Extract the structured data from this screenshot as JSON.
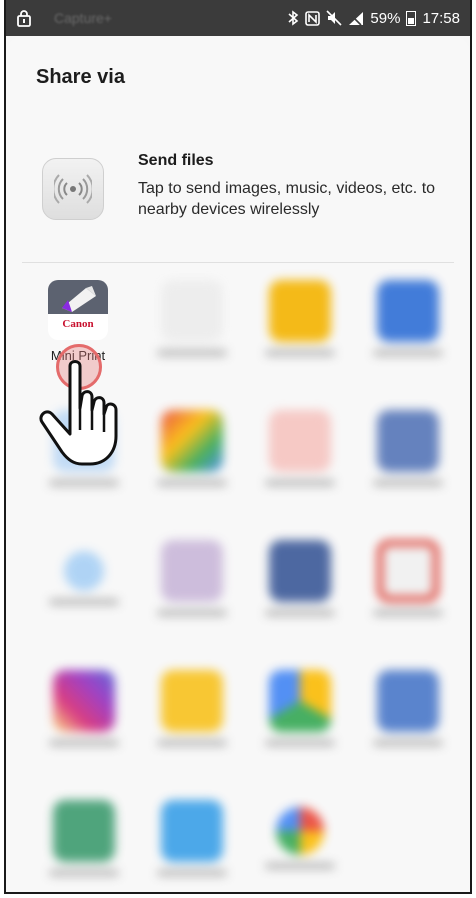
{
  "status_bar": {
    "ghost_app_text": "Capture+",
    "battery_percent": "59%",
    "time": "17:58",
    "icons": [
      "lock-icon",
      "bluetooth-icon",
      "nfc-icon",
      "mute-icon",
      "signal-icon",
      "battery-icon"
    ]
  },
  "sheet": {
    "title": "Share via",
    "send_files": {
      "title": "Send files",
      "description": "Tap to send images, music, videos, etc. to nearby devices wirelessly"
    }
  },
  "apps": [
    {
      "id": "canon",
      "brand": "Canon",
      "label": "Mini Print",
      "icon": "canon-mini-print-icon"
    },
    {
      "id": "app2",
      "icon": "pencil-app-icon",
      "color": "#e8e8e8"
    },
    {
      "id": "app3",
      "icon": "yellow-app-icon",
      "color": "#f4b400"
    },
    {
      "id": "app4",
      "icon": "bluetooth-app-icon",
      "color": "#2f6fd6"
    },
    {
      "id": "app5",
      "icon": "blue-app-icon",
      "color": "#bcd8f5"
    },
    {
      "id": "app6",
      "icon": "maps-app-icon",
      "color": "#34a853"
    },
    {
      "id": "app7",
      "icon": "red-app-icon",
      "color": "#f6c4c0"
    },
    {
      "id": "app8",
      "icon": "camera-app-icon",
      "color": "#5676b8"
    },
    {
      "id": "app9",
      "icon": "circle-app-icon",
      "color": "#a8d0f5"
    },
    {
      "id": "app10",
      "icon": "grid-app-icon",
      "color": "#c9b7d9"
    },
    {
      "id": "app11",
      "icon": "facebook-icon",
      "color": "#3b5998"
    },
    {
      "id": "app12",
      "icon": "gmail-icon",
      "color": "#f1f1f1"
    },
    {
      "id": "app13",
      "icon": "instagram-icon",
      "color": "#c13584"
    },
    {
      "id": "app14",
      "icon": "slides-icon",
      "color": "#f8c21e"
    },
    {
      "id": "app15",
      "icon": "drive-icon",
      "color": "#f1f1f1"
    },
    {
      "id": "app16",
      "icon": "docs-app-icon",
      "color": "#4a78c9"
    },
    {
      "id": "app17",
      "icon": "green-app-icon",
      "color": "#3d9b6f"
    },
    {
      "id": "app18",
      "icon": "cloud-icon",
      "color": "#3aa0e8"
    },
    {
      "id": "app19",
      "icon": "photos-icon",
      "color": "#f1f1f1"
    }
  ],
  "colors": {
    "status_bar": "#3b3b3b",
    "sheet": "#f8f8f8",
    "tap_highlight": "#e46b6b"
  }
}
